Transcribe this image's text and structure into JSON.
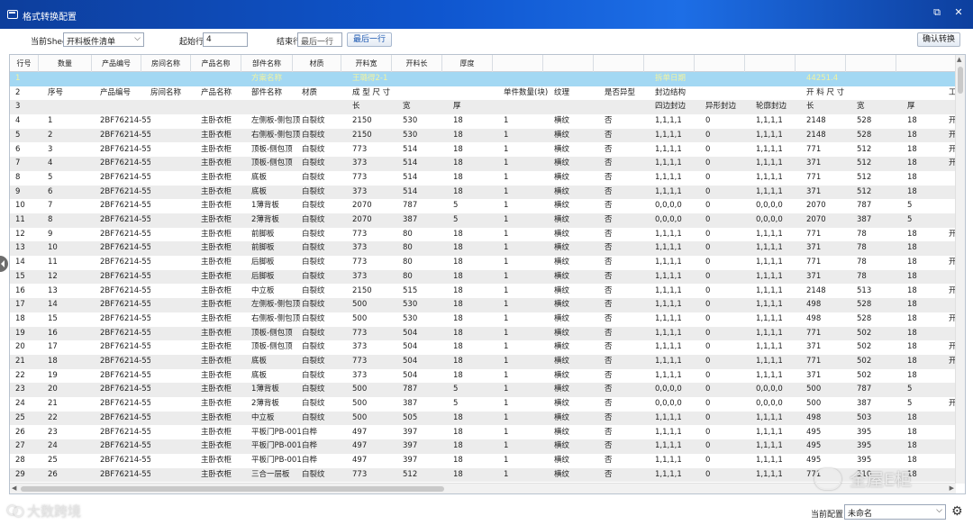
{
  "window": {
    "title": "格式转换配置",
    "restore_glyph": "⧉",
    "close_glyph": "✕"
  },
  "toolbar": {
    "sheet_label": "当前Sheet",
    "sheet_value": "开料板件清单",
    "start_label": "起始行",
    "start_value": "4",
    "end_label": "结束行",
    "end_placeholder": "最后一行",
    "last_row_button": "最后一行",
    "confirm_button": "确认转换"
  },
  "grid": {
    "headers": [
      "行号",
      "数量",
      "产品编号",
      "房间名称",
      "产品名称",
      "部件名称",
      "材质",
      "开料宽",
      "开料长",
      "厚度",
      "",
      "",
      "",
      "",
      "",
      "",
      "",
      "",
      ""
    ],
    "rows": [
      [
        "1",
        "",
        "",
        "",
        "",
        "方案名称",
        "",
        "王璐得2-1",
        "",
        "",
        "",
        "",
        "",
        "",
        "",
        "",
        "",
        "",
        ""
      ],
      [
        "2",
        "序号",
        "产品编号",
        "房间名称",
        "产品名称",
        "部件名称",
        "材质",
        "成 型 尺 寸",
        "",
        "",
        "单件数量(块)",
        "纹理",
        "是否异型",
        "封边结构",
        "",
        "",
        "开 料 尺 寸",
        "",
        ""
      ],
      [
        "3",
        "",
        "",
        "",
        "",
        "",
        "",
        "长",
        "宽",
        "厚",
        "",
        "",
        "",
        "四边封边",
        "异形封边",
        "轮廓封边",
        "长",
        "宽",
        "厚"
      ],
      [
        "4",
        "1",
        "2BF76214-55(主卧",
        "",
        "主卧衣柜",
        "左侧板-侧包顶",
        "白裂纹",
        "2150",
        "530",
        "18",
        "1",
        "横纹",
        "否",
        "1,1,1,1",
        "0",
        "1,1,1,1",
        "2148",
        "528",
        "18"
      ],
      [
        "5",
        "2",
        "2BF76214-55(主卧",
        "",
        "主卧衣柜",
        "右侧板-侧包顶",
        "白裂纹",
        "2150",
        "530",
        "18",
        "1",
        "横纹",
        "否",
        "1,1,1,1",
        "0",
        "1,1,1,1",
        "2148",
        "528",
        "18"
      ],
      [
        "6",
        "3",
        "2BF76214-55(主卧",
        "",
        "主卧衣柜",
        "顶板-侧包顶",
        "白裂纹",
        "773",
        "514",
        "18",
        "1",
        "横纹",
        "否",
        "1,1,1,1",
        "0",
        "1,1,1,1",
        "771",
        "512",
        "18"
      ],
      [
        "7",
        "4",
        "2BF76214-55(主卧",
        "",
        "主卧衣柜",
        "顶板-侧包顶",
        "白裂纹",
        "373",
        "514",
        "18",
        "1",
        "横纹",
        "否",
        "1,1,1,1",
        "0",
        "1,1,1,1",
        "371",
        "512",
        "18"
      ],
      [
        "8",
        "5",
        "2BF76214-55(主卧",
        "",
        "主卧衣柜",
        "底板",
        "白裂纹",
        "773",
        "514",
        "18",
        "1",
        "横纹",
        "否",
        "1,1,1,1",
        "0",
        "1,1,1,1",
        "771",
        "512",
        "18"
      ],
      [
        "9",
        "6",
        "2BF76214-55(主卧",
        "",
        "主卧衣柜",
        "底板",
        "白裂纹",
        "373",
        "514",
        "18",
        "1",
        "横纹",
        "否",
        "1,1,1,1",
        "0",
        "1,1,1,1",
        "371",
        "512",
        "18"
      ],
      [
        "10",
        "7",
        "2BF76214-55(主卧",
        "",
        "主卧衣柜",
        "1薄背板",
        "白裂纹",
        "2070",
        "787",
        "5",
        "1",
        "横纹",
        "否",
        "0,0,0,0",
        "0",
        "0,0,0,0",
        "2070",
        "787",
        "5"
      ],
      [
        "11",
        "8",
        "2BF76214-55(主卧",
        "",
        "主卧衣柜",
        "2薄背板",
        "白裂纹",
        "2070",
        "387",
        "5",
        "1",
        "横纹",
        "否",
        "0,0,0,0",
        "0",
        "0,0,0,0",
        "2070",
        "387",
        "5"
      ],
      [
        "12",
        "9",
        "2BF76214-55(主卧",
        "",
        "主卧衣柜",
        "前脚板",
        "白裂纹",
        "773",
        "80",
        "18",
        "1",
        "横纹",
        "否",
        "1,1,1,1",
        "0",
        "1,1,1,1",
        "771",
        "78",
        "18"
      ],
      [
        "13",
        "10",
        "2BF76214-55(主卧",
        "",
        "主卧衣柜",
        "前脚板",
        "白裂纹",
        "373",
        "80",
        "18",
        "1",
        "横纹",
        "否",
        "1,1,1,1",
        "0",
        "1,1,1,1",
        "371",
        "78",
        "18"
      ],
      [
        "14",
        "11",
        "2BF76214-55(主卧",
        "",
        "主卧衣柜",
        "后脚板",
        "白裂纹",
        "773",
        "80",
        "18",
        "1",
        "横纹",
        "否",
        "1,1,1,1",
        "0",
        "1,1,1,1",
        "771",
        "78",
        "18"
      ],
      [
        "15",
        "12",
        "2BF76214-55(主卧",
        "",
        "主卧衣柜",
        "后脚板",
        "白裂纹",
        "373",
        "80",
        "18",
        "1",
        "横纹",
        "否",
        "1,1,1,1",
        "0",
        "1,1,1,1",
        "371",
        "78",
        "18"
      ],
      [
        "16",
        "13",
        "2BF76214-55(主卧",
        "",
        "主卧衣柜",
        "中立板",
        "白裂纹",
        "2150",
        "515",
        "18",
        "1",
        "横纹",
        "否",
        "1,1,1,1",
        "0",
        "1,1,1,1",
        "2148",
        "513",
        "18"
      ],
      [
        "17",
        "14",
        "2BF76214-55(主卧",
        "",
        "主卧衣柜",
        "左侧板-侧包顶",
        "白裂纹",
        "500",
        "530",
        "18",
        "1",
        "横纹",
        "否",
        "1,1,1,1",
        "0",
        "1,1,1,1",
        "498",
        "528",
        "18"
      ],
      [
        "18",
        "15",
        "2BF76214-55(主卧",
        "",
        "主卧衣柜",
        "右侧板-侧包顶",
        "白裂纹",
        "500",
        "530",
        "18",
        "1",
        "横纹",
        "否",
        "1,1,1,1",
        "0",
        "1,1,1,1",
        "498",
        "528",
        "18"
      ],
      [
        "19",
        "16",
        "2BF76214-55(主卧",
        "",
        "主卧衣柜",
        "顶板-侧包顶",
        "白裂纹",
        "773",
        "504",
        "18",
        "1",
        "横纹",
        "否",
        "1,1,1,1",
        "0",
        "1,1,1,1",
        "771",
        "502",
        "18"
      ],
      [
        "20",
        "17",
        "2BF76214-55(主卧",
        "",
        "主卧衣柜",
        "顶板-侧包顶",
        "白裂纹",
        "373",
        "504",
        "18",
        "1",
        "横纹",
        "否",
        "1,1,1,1",
        "0",
        "1,1,1,1",
        "371",
        "502",
        "18"
      ],
      [
        "21",
        "18",
        "2BF76214-55(主卧",
        "",
        "主卧衣柜",
        "底板",
        "白裂纹",
        "773",
        "504",
        "18",
        "1",
        "横纹",
        "否",
        "1,1,1,1",
        "0",
        "1,1,1,1",
        "771",
        "502",
        "18"
      ],
      [
        "22",
        "19",
        "2BF76214-55(主卧",
        "",
        "主卧衣柜",
        "底板",
        "白裂纹",
        "373",
        "504",
        "18",
        "1",
        "横纹",
        "否",
        "1,1,1,1",
        "0",
        "1,1,1,1",
        "371",
        "502",
        "18"
      ],
      [
        "23",
        "20",
        "2BF76214-55(主卧",
        "",
        "主卧衣柜",
        "1薄背板",
        "白裂纹",
        "500",
        "787",
        "5",
        "1",
        "横纹",
        "否",
        "0,0,0,0",
        "0",
        "0,0,0,0",
        "500",
        "787",
        "5"
      ],
      [
        "24",
        "21",
        "2BF76214-55(主卧",
        "",
        "主卧衣柜",
        "2薄背板",
        "白裂纹",
        "500",
        "387",
        "5",
        "1",
        "横纹",
        "否",
        "0,0,0,0",
        "0",
        "0,0,0,0",
        "500",
        "387",
        "5"
      ],
      [
        "25",
        "22",
        "2BF76214-55(主卧",
        "",
        "主卧衣柜",
        "中立板",
        "白裂纹",
        "500",
        "505",
        "18",
        "1",
        "横纹",
        "否",
        "1,1,1,1",
        "0",
        "1,1,1,1",
        "498",
        "503",
        "18"
      ],
      [
        "26",
        "23",
        "2BF76214-55(主卧",
        "",
        "主卧衣柜",
        "平板门PB-001",
        "白桦",
        "497",
        "397",
        "18",
        "1",
        "横纹",
        "否",
        "1,1,1,1",
        "0",
        "1,1,1,1",
        "495",
        "395",
        "18"
      ],
      [
        "27",
        "24",
        "2BF76214-55(主卧",
        "",
        "主卧衣柜",
        "平板门PB-001",
        "白桦",
        "497",
        "397",
        "18",
        "1",
        "横纹",
        "否",
        "1,1,1,1",
        "0",
        "1,1,1,1",
        "495",
        "395",
        "18"
      ],
      [
        "28",
        "25",
        "2BF76214-55(主卧",
        "",
        "主卧衣柜",
        "平板门PB-001",
        "白桦",
        "497",
        "397",
        "18",
        "1",
        "横纹",
        "否",
        "1,1,1,1",
        "0",
        "1,1,1,1",
        "495",
        "395",
        "18"
      ],
      [
        "29",
        "26",
        "2BF76214-55(主卧",
        "",
        "主卧衣柜",
        "三合一层板",
        "白裂纹",
        "773",
        "512",
        "18",
        "1",
        "横纹",
        "否",
        "1,1,1,1",
        "0",
        "1,1,1,1",
        "771",
        "510",
        "18"
      ]
    ],
    "row1_extra": {
      "label": "拆单日期",
      "value": "44251.4"
    },
    "row2_extra": "工",
    "trailing_col": [
      "",
      "",
      "",
      "开",
      "开",
      "开",
      "开",
      "",
      "",
      "",
      "",
      "开",
      "",
      "开",
      "",
      "开",
      "",
      "开",
      "",
      "开",
      "开",
      "",
      "",
      "开",
      "",
      "",
      "",
      ""
    ]
  },
  "statusbar": {
    "config_label": "当前配置",
    "config_value": "未命名",
    "gear_glyph": "⚙"
  },
  "watermarks": {
    "left": "大数跨境",
    "right": "全屋E柜"
  }
}
